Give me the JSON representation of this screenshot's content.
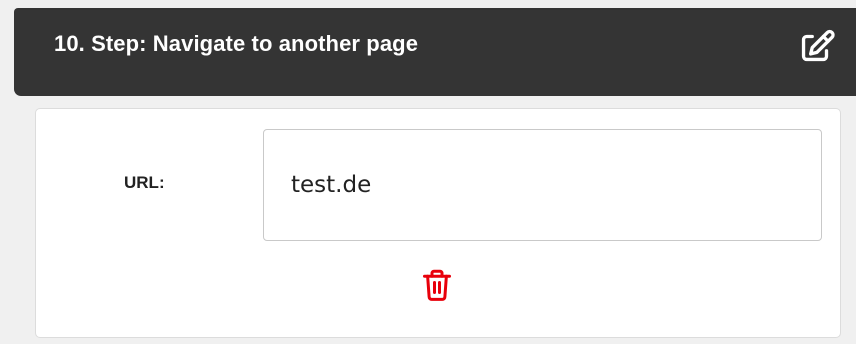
{
  "step": {
    "title": "10. Step: Navigate to another page",
    "edit_icon": "pencil-square-icon",
    "url_label": "URL:",
    "url_value": "test.de",
    "delete_icon": "trash-icon"
  },
  "colors": {
    "header_bg": "#343434",
    "header_text": "#ffffff",
    "delete_icon": "#e8000b",
    "page_bg": "#f0f0f0",
    "card_bg": "#ffffff"
  }
}
